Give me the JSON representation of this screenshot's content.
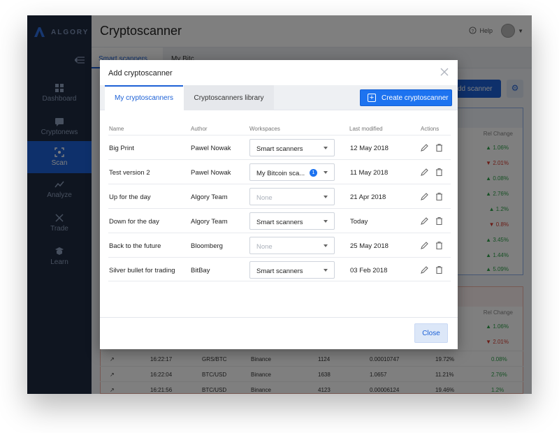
{
  "app": {
    "logo": "ALGORY",
    "title": "Cryptoscanner",
    "help": "Help"
  },
  "sidebar": {
    "items": [
      {
        "label": "Dashboard",
        "icon": "dashboard-icon"
      },
      {
        "label": "Cryptonews",
        "icon": "news-icon"
      },
      {
        "label": "Scan",
        "icon": "scan-icon",
        "active": true
      },
      {
        "label": "Analyze",
        "icon": "analyze-icon"
      },
      {
        "label": "Trade",
        "icon": "trade-icon"
      },
      {
        "label": "Learn",
        "icon": "learn-icon"
      }
    ]
  },
  "workspace_tabs": [
    "Smart scanners",
    "My Bitc"
  ],
  "background": {
    "add_scanner": "dd scanner",
    "rel_change_header": "Rel Change",
    "blue_rel_changes": [
      "1.06%",
      "2.01%",
      "0.08%",
      "2.76%",
      "1.2%",
      "0.8%",
      "3.45%",
      "1.44%",
      "5.09%"
    ],
    "red_rel_changes": [
      "1.06%",
      "2.01%",
      "0.08%",
      "2.76%",
      "1.2%"
    ],
    "rows": [
      {
        "time": "16:22:17",
        "pair": "GRS/BTC",
        "exchange": "Binance",
        "count": "1124",
        "price": "0.00010747",
        "pct": "19.72%",
        "rel": "0.08%"
      },
      {
        "time": "16:22:04",
        "pair": "BTC/USD",
        "exchange": "Binance",
        "count": "1638",
        "price": "1.0657",
        "pct": "11.21%",
        "rel": "2.76%"
      },
      {
        "time": "16:21:56",
        "pair": "BTC/USD",
        "exchange": "Binance",
        "count": "4123",
        "price": "0.00006124",
        "pct": "19.46%",
        "rel": "1.2%"
      }
    ]
  },
  "modal": {
    "title": "Add cryptoscanner",
    "tabs": {
      "mine": "My cryptoscanners",
      "library": "Cryptoscanners library"
    },
    "create_button": "Create cryptoscanner",
    "columns": {
      "name": "Name",
      "author": "Author",
      "workspaces": "Workspaces",
      "last_modified": "Last modified",
      "actions": "Actions"
    },
    "rows": [
      {
        "name": "Big Print",
        "author": "Pawel Nowak",
        "workspace": "Smart scanners",
        "modified": "12 May 2018"
      },
      {
        "name": "Test version 2",
        "author": "Pawel Nowak",
        "workspace": "My Bitcoin sca...",
        "badge": "1",
        "modified": "11 May 2018"
      },
      {
        "name": "Up for the day",
        "author": "Algory Team",
        "workspace": "None",
        "modified": "21 Apr 2018"
      },
      {
        "name": "Down for the day",
        "author": "Algory Team",
        "workspace": "Smart scanners",
        "modified": "Today"
      },
      {
        "name": "Back to the future",
        "author": "Bloomberg",
        "workspace": "None",
        "modified": "25 May 2018"
      },
      {
        "name": "Silver bullet for trading",
        "author": "BitBay",
        "workspace": "Smart scanners",
        "modified": "03 Feb 2018"
      }
    ],
    "close_button": "Close"
  },
  "colors": {
    "accent": "#1d61d6",
    "sidebar": "#1f2b40",
    "positive": "#2fa24a",
    "negative": "#d63b2f"
  }
}
